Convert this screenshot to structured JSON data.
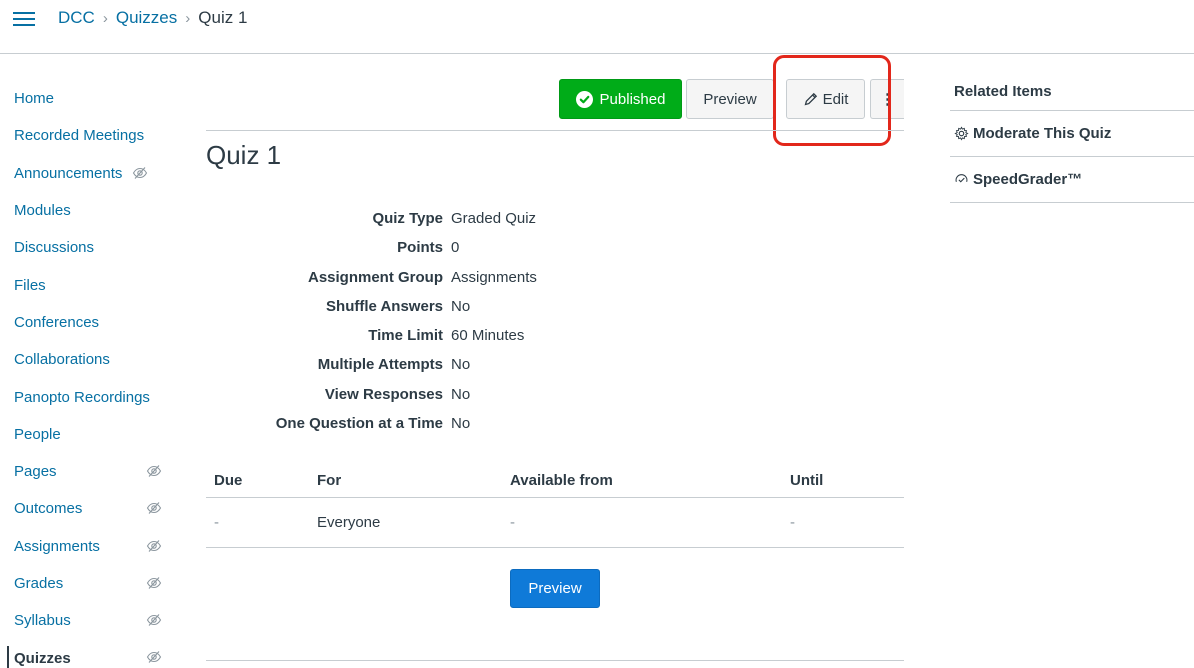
{
  "breadcrumb": {
    "items": [
      "DCC",
      "Quizzes"
    ],
    "current": "Quiz 1"
  },
  "course_nav": {
    "items": [
      {
        "label": "Home",
        "hidden": false
      },
      {
        "label": "Recorded Meetings",
        "hidden": false
      },
      {
        "label": "Announcements",
        "hidden": true
      },
      {
        "label": "Modules",
        "hidden": false
      },
      {
        "label": "Discussions",
        "hidden": false
      },
      {
        "label": "Files",
        "hidden": false
      },
      {
        "label": "Conferences",
        "hidden": false
      },
      {
        "label": "Collaborations",
        "hidden": false
      },
      {
        "label": "Panopto Recordings",
        "hidden": false
      },
      {
        "label": "People",
        "hidden": false
      },
      {
        "label": "Pages",
        "hidden": true
      },
      {
        "label": "Outcomes",
        "hidden": true
      },
      {
        "label": "Assignments",
        "hidden": true
      },
      {
        "label": "Grades",
        "hidden": true
      },
      {
        "label": "Syllabus",
        "hidden": true
      },
      {
        "label": "Quizzes",
        "hidden": true,
        "active": true
      }
    ]
  },
  "header": {
    "published_label": "Published",
    "preview_label": "Preview",
    "edit_label": "Edit",
    "more_label": "⋮"
  },
  "quiz": {
    "title": "Quiz 1",
    "details": [
      {
        "label": "Quiz Type",
        "value": "Graded Quiz"
      },
      {
        "label": "Points",
        "value": "0"
      },
      {
        "label": "Assignment Group",
        "value": "Assignments"
      },
      {
        "label": "Shuffle Answers",
        "value": "No"
      },
      {
        "label": "Time Limit",
        "value": "60 Minutes"
      },
      {
        "label": "Multiple Attempts",
        "value": "No"
      },
      {
        "label": "View Responses",
        "value": "No"
      },
      {
        "label": "One Question at a Time",
        "value": "No"
      }
    ]
  },
  "dates_table": {
    "headers": [
      "Due",
      "For",
      "Available from",
      "Until"
    ],
    "rows": [
      [
        "-",
        "Everyone",
        "-",
        "-"
      ]
    ]
  },
  "preview_button_label": "Preview",
  "related": {
    "title": "Related Items",
    "items": [
      "Moderate This Quiz",
      "SpeedGrader™"
    ]
  },
  "colors": {
    "link": "#0770a3",
    "published": "#00ac18",
    "primary": "#0f7ad8",
    "highlight": "#e2271b"
  }
}
